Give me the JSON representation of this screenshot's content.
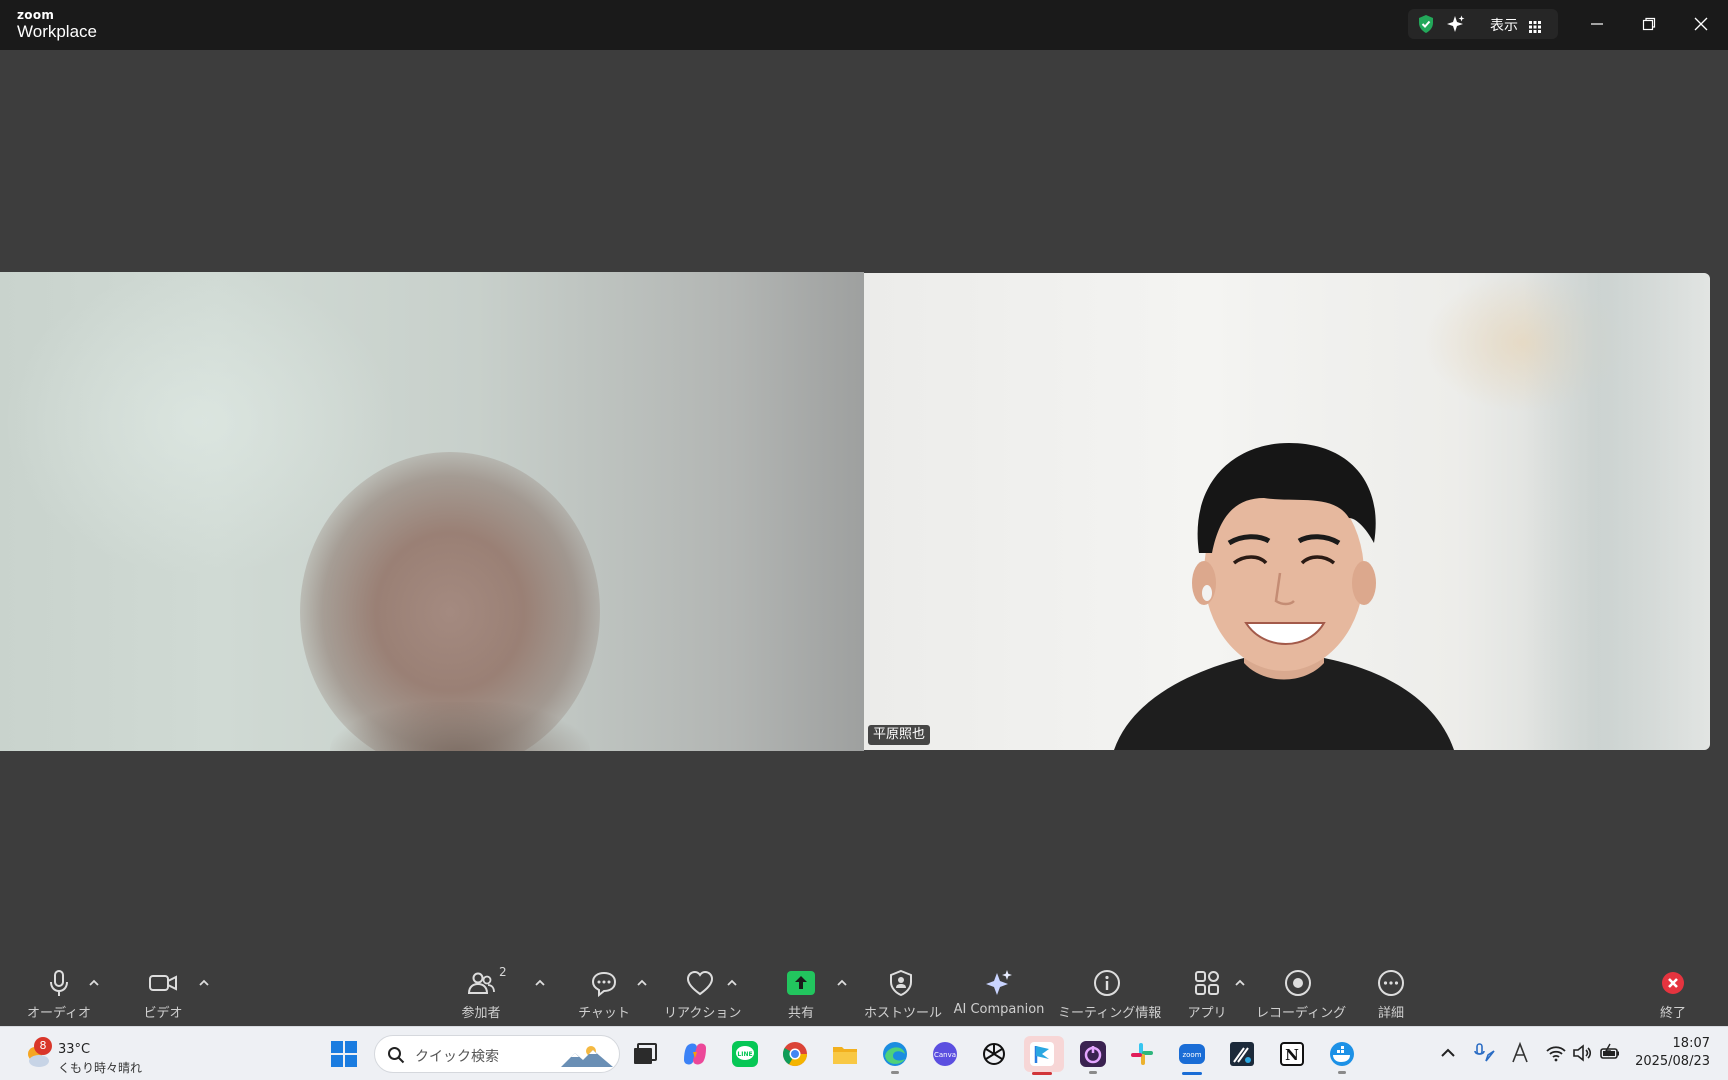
{
  "app": {
    "logo_top": "zoom",
    "logo_bottom": "Workplace",
    "view_label": "表示"
  },
  "participants": {
    "right_name": "平原照也",
    "count": "2"
  },
  "toolbar": {
    "audio": "オーディオ",
    "video": "ビデオ",
    "participants": "参加者",
    "chat": "チャット",
    "reaction": "リアクション",
    "share": "共有",
    "host_tools": "ホストツール",
    "ai_companion": "AI Companion",
    "meeting_info": "ミーティング情報",
    "apps": "アプリ",
    "recording": "レコーディング",
    "more": "詳細",
    "end": "終了"
  },
  "taskbar": {
    "weather_badge": "8",
    "temperature": "33°C",
    "weather_desc": "くもり時々晴れ",
    "search_placeholder": "クイック検索",
    "time": "18:07",
    "date": "2025/08/23"
  },
  "colors": {
    "share_green": "#22c55e",
    "end_red": "#e5343f",
    "shield_green": "#23a85a"
  }
}
